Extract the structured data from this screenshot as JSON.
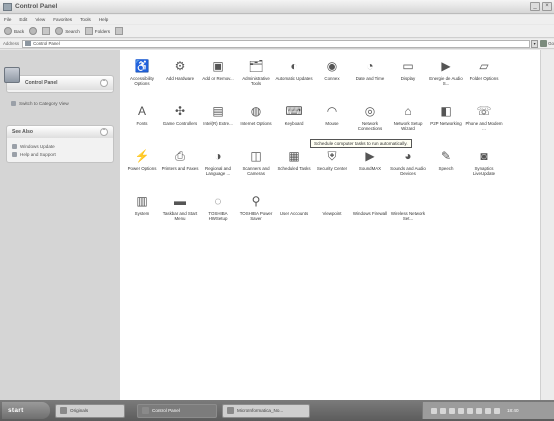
{
  "window": {
    "title": "Control Panel"
  },
  "menu": [
    "File",
    "Edit",
    "View",
    "Favorites",
    "Tools",
    "Help"
  ],
  "toolbar": {
    "back": "Back",
    "search": "Search",
    "folders": "Folders"
  },
  "address": {
    "label": "Address",
    "value": "Control Panel",
    "go": "Go"
  },
  "sidebar": {
    "control_panel": {
      "title": "Control Panel",
      "link": "Switch to Category View"
    },
    "see_also": {
      "title": "See Also",
      "links": [
        "Windows Update",
        "Help and Support"
      ]
    }
  },
  "items": [
    {
      "label": "Accessibility Options",
      "icon": "accessibility-icon",
      "glyph": "♿"
    },
    {
      "label": "Add Hardware",
      "icon": "add-hardware-icon",
      "glyph": "⚙"
    },
    {
      "label": "Add or Remov...",
      "icon": "add-remove-programs-icon",
      "glyph": "▣"
    },
    {
      "label": "Administrative Tools",
      "icon": "admin-tools-icon",
      "glyph": "🗂"
    },
    {
      "label": "Automatic Updates",
      "icon": "automatic-updates-icon",
      "glyph": "◐"
    },
    {
      "label": "Connex",
      "icon": "connex-icon",
      "glyph": "◉"
    },
    {
      "label": "Date and Time",
      "icon": "date-time-icon",
      "glyph": "◔"
    },
    {
      "label": "Display",
      "icon": "display-icon",
      "glyph": "▭"
    },
    {
      "label": "Energie de Audio S...",
      "icon": "energy-audio-icon",
      "glyph": "▶"
    },
    {
      "label": "Folder Options",
      "icon": "folder-options-icon",
      "glyph": "▱"
    },
    {
      "label": "",
      "icon": "",
      "glyph": ""
    },
    {
      "label": "Fonts",
      "icon": "fonts-icon",
      "glyph": "A"
    },
    {
      "label": "Game Controllers",
      "icon": "game-controllers-icon",
      "glyph": "✣"
    },
    {
      "label": "Intel(R) Extre...",
      "icon": "intel-graphics-icon",
      "glyph": "▤"
    },
    {
      "label": "Internet Options",
      "icon": "internet-options-icon",
      "glyph": "◍"
    },
    {
      "label": "Keyboard",
      "icon": "keyboard-icon",
      "glyph": "⌨"
    },
    {
      "label": "Mouse",
      "icon": "mouse-icon",
      "glyph": "◠"
    },
    {
      "label": "Network Connections",
      "icon": "network-connections-icon",
      "glyph": "◎"
    },
    {
      "label": "Network Setup Wizard",
      "icon": "network-setup-icon",
      "glyph": "⌂"
    },
    {
      "label": "P2P Networking",
      "icon": "p2p-networking-icon",
      "glyph": "◧"
    },
    {
      "label": "Phone and Modem ...",
      "icon": "phone-modem-icon",
      "glyph": "☏"
    },
    {
      "label": "",
      "icon": "",
      "glyph": ""
    },
    {
      "label": "Power Options",
      "icon": "power-options-icon",
      "glyph": "⚡"
    },
    {
      "label": "Printers and Faxes",
      "icon": "printers-faxes-icon",
      "glyph": "⎙"
    },
    {
      "label": "Regional and Language ...",
      "icon": "regional-language-icon",
      "glyph": "◑"
    },
    {
      "label": "Scanners and Cameras",
      "icon": "scanners-cameras-icon",
      "glyph": "◫"
    },
    {
      "label": "Scheduled Tasks",
      "icon": "scheduled-tasks-icon",
      "glyph": "▦"
    },
    {
      "label": "Security Center",
      "icon": "security-center-icon",
      "glyph": "⛨"
    },
    {
      "label": "SoundMAX",
      "icon": "soundmax-icon",
      "glyph": "▶"
    },
    {
      "label": "Sounds and Audio Devices",
      "icon": "sounds-audio-icon",
      "glyph": "◕"
    },
    {
      "label": "Speech",
      "icon": "speech-icon",
      "glyph": "✎"
    },
    {
      "label": "Synaptics LiveUpdate",
      "icon": "synaptics-liveupdate-icon",
      "glyph": "◙"
    },
    {
      "label": "",
      "icon": "",
      "glyph": ""
    },
    {
      "label": "System",
      "icon": "system-icon",
      "glyph": "▥"
    },
    {
      "label": "Taskbar and Start Menu",
      "icon": "taskbar-start-icon",
      "glyph": "▬"
    },
    {
      "label": "TOSHIBA HWSetup",
      "icon": "toshiba-hwsetup-icon",
      "glyph": "◌"
    },
    {
      "label": "TOSHIBA Power Saver",
      "icon": "toshiba-power-icon",
      "glyph": "⚲"
    },
    {
      "label": "User Accounts",
      "icon": "user-accounts-icon",
      "glyph": ""
    },
    {
      "label": "Viewpoint",
      "icon": "viewpoint-icon",
      "glyph": ""
    },
    {
      "label": "Windows Firewall",
      "icon": "windows-firewall-icon",
      "glyph": ""
    },
    {
      "label": "Wireless Network Set...",
      "icon": "wireless-network-icon",
      "glyph": ""
    }
  ],
  "tooltip": "Schedule computer tasks to run automatically.",
  "taskbar": {
    "start": "start",
    "tasks": [
      {
        "label": "Originals",
        "active": false
      },
      {
        "label": "Control Panel",
        "active": true
      },
      {
        "label": "MicroInformatica_No...",
        "active": false
      }
    ],
    "clock": "18:40"
  }
}
